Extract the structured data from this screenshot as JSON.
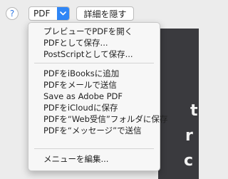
{
  "toolbar": {
    "help_label": "?",
    "pdf_label": "PDF",
    "details_label": "詳細を隠す"
  },
  "menu": {
    "group1": [
      "プレビューでPDFを開く",
      "PDFとして保存...",
      "PostScriptとして保存..."
    ],
    "group2": [
      "PDFをiBooksに追加",
      "PDFをメールで送信",
      "Save as Adobe PDF",
      "PDFをiCloudに保存",
      "PDFを“Web受信”フォルダに保存",
      "PDFを“メッセージ”で送信"
    ],
    "group3": [
      "メニューを編集..."
    ]
  },
  "background": {
    "glyph1": "t",
    "glyph2": "r",
    "glyph3": "c"
  },
  "colors": {
    "accent": "#2f86f6",
    "window_bg": "#ececec",
    "menu_bg": "#f7f7f7",
    "preview_bg": "#3a3a3e"
  },
  "icons": {
    "pdf_dropdown": "chevron-down-icon",
    "help": "question-mark-icon"
  }
}
